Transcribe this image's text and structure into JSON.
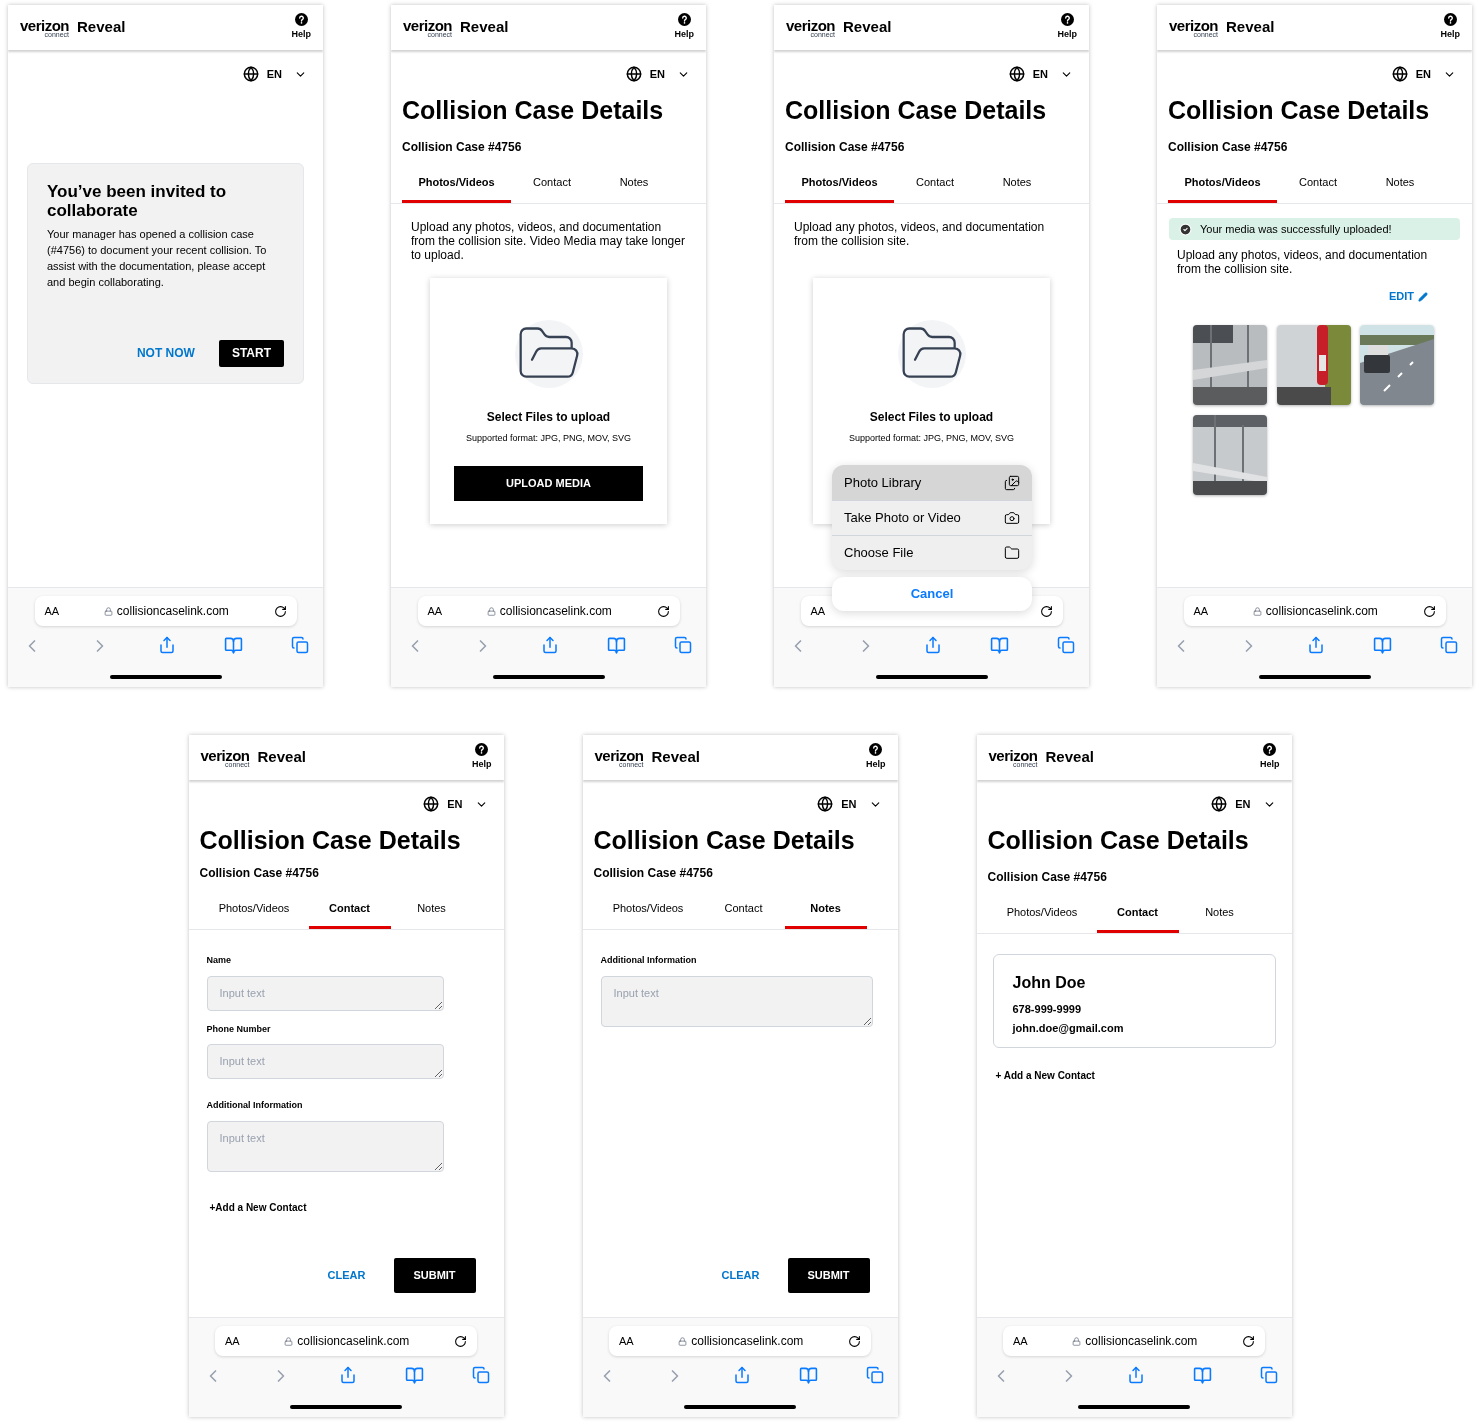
{
  "screens": [
    {
      "kind": "invite",
      "brand": "verizon",
      "brand_sub": "connect",
      "app": "Reveal",
      "help": "Help",
      "language": "EN",
      "url": "collisioncaselink.com",
      "text_size": "AA",
      "title": "You’ve been invited to collaborate",
      "body": "Your manager has opened a collision case (#4756) to document your recent collision. To assist with the documentation, please accept and begin collaborating.",
      "buttons": [
        "NOT NOW",
        "START"
      ]
    },
    {
      "kind": "upload",
      "brand": "verizon",
      "brand_sub": "connect",
      "app": "Reveal",
      "help": "Help",
      "language": "EN",
      "url": "collisioncaselink.com",
      "text_size": "AA",
      "title": "Collision Case Details",
      "case": "Collision Case #4756",
      "tabs": [
        {
          "label": "Photos/Videos",
          "selected": true
        },
        {
          "label": "Contact",
          "selected": false
        },
        {
          "label": "Notes",
          "selected": false
        }
      ],
      "intro": "Upload any photos, videos, and documentation from the collision site. Video Media may take longer to upload.",
      "card_title": "Select Files to upload",
      "formats": "Supported format: JPG, PNG, MOV, SVG",
      "button": "UPLOAD MEDIA"
    },
    {
      "kind": "upload_menu",
      "brand": "verizon",
      "brand_sub": "connect",
      "app": "Reveal",
      "help": "Help",
      "language": "EN",
      "text_size": "AA",
      "title": "Collision Case Details",
      "case": "Collision Case #4756",
      "tabs": [
        {
          "label": "Photos/Videos",
          "selected": true
        },
        {
          "label": "Contact",
          "selected": false
        },
        {
          "label": "Notes",
          "selected": false
        }
      ],
      "intro": "Upload any photos, videos, and documentation from the collision site.",
      "card_title": "Select Files to upload",
      "formats": "Supported format: JPG, PNG, MOV, SVG",
      "menu": [
        {
          "label": "Photo Library",
          "kind": "library",
          "selected": true
        },
        {
          "label": "Take Photo or Video",
          "kind": "camera",
          "selected": false
        },
        {
          "label": "Choose File",
          "kind": "file",
          "selected": false
        }
      ],
      "cancel": "Cancel"
    },
    {
      "kind": "uploaded",
      "brand": "verizon",
      "brand_sub": "connect",
      "app": "Reveal",
      "help": "Help",
      "language": "EN",
      "url": "collisioncaselink.com",
      "text_size": "AA",
      "title": "Collision Case Details",
      "case": "Collision Case #4756",
      "tabs": [
        {
          "label": "Photos/Videos",
          "selected": true
        },
        {
          "label": "Contact",
          "selected": false
        },
        {
          "label": "Notes",
          "selected": false
        }
      ],
      "alert": "Your media was successfully uploaded!",
      "intro": "Upload any photos, videos, and documentation from the collision site.",
      "edit": "EDIT",
      "photos": [
        {
          "kind": "picture"
        },
        {
          "kind": "picture"
        },
        {
          "kind": "picture"
        },
        {
          "kind": "picture"
        }
      ]
    },
    {
      "kind": "form",
      "brand": "verizon",
      "brand_sub": "connect",
      "app": "Reveal",
      "help": "Help",
      "language": "EN",
      "url": "collisioncaselink.com",
      "text_size": "AA",
      "title": "Collision Case Details",
      "case": "Collision Case #4756",
      "tabs": [
        {
          "label": "Photos/Videos",
          "selected": false
        },
        {
          "label": "Contact",
          "selected": true
        },
        {
          "label": "Notes",
          "selected": false
        }
      ],
      "fields": [
        {
          "label": "Name",
          "placeholder": "Input text",
          "kind": "line"
        },
        {
          "label": "Phone Number",
          "placeholder": "Input text",
          "kind": "line"
        },
        {
          "label": "Additional Information",
          "placeholder": "Input text",
          "kind": "area"
        }
      ],
      "link": "+Add a New Contact",
      "buttons": [
        "CLEAR",
        "SUBMIT"
      ]
    },
    {
      "kind": "form",
      "brand": "verizon",
      "brand_sub": "connect",
      "app": "Reveal",
      "help": "Help",
      "language": "EN",
      "url": "collisioncaselink.com",
      "text_size": "AA",
      "title": "Collision Case Details",
      "case": "Collision Case #4756",
      "tabs": [
        {
          "label": "Photos/Videos",
          "selected": false
        },
        {
          "label": "Contact",
          "selected": false
        },
        {
          "label": "Notes",
          "selected": true
        }
      ],
      "fields": [
        {
          "label": "Additional Information",
          "placeholder": "Input text",
          "kind": "area"
        }
      ],
      "buttons": [
        "CLEAR",
        "SUBMIT"
      ]
    },
    {
      "kind": "contact_card",
      "brand": "verizon",
      "brand_sub": "connect",
      "app": "Reveal",
      "help": "Help",
      "language": "EN",
      "url": "collisioncaselink.com",
      "text_size": "AA",
      "title": "Collision Case Details",
      "case": "Collision Case #4756",
      "tabs": [
        {
          "label": "Photos/Videos",
          "selected": false
        },
        {
          "label": "Contact",
          "selected": true
        },
        {
          "label": "Notes",
          "selected": false
        }
      ],
      "contact": {
        "name": "John Doe",
        "phone": "678-999-9999",
        "email": "john.doe@gmail.com"
      },
      "link": "+ Add a New Contact"
    }
  ]
}
